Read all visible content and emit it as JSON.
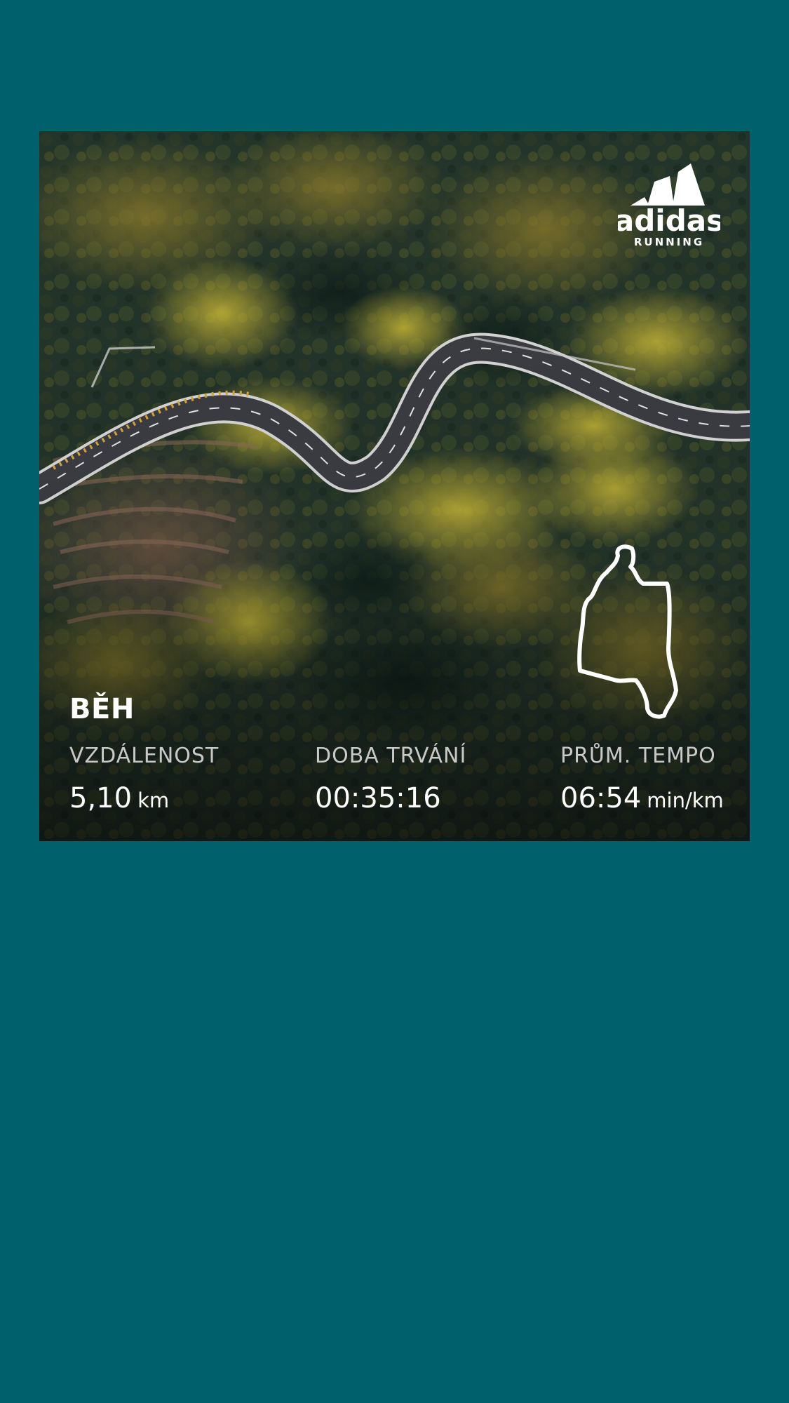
{
  "share_card": {
    "brand": {
      "logo_text": "adidas",
      "logo_subtext": "RUNNING",
      "logo_icon": "adidas-three-stripes-icon"
    },
    "background_image": "aerial-forest-winding-road-photo",
    "route_icon": "route-outline-icon",
    "activity_title": "BĚH",
    "stats": [
      {
        "label": "VZDÁLENOST",
        "value": "5,10",
        "unit": "km"
      },
      {
        "label": "DOBA TRVÁNÍ",
        "value": "00:35:16",
        "unit": ""
      },
      {
        "label": "PRŮM. TEMPO",
        "value": "06:54",
        "unit": "min/km"
      }
    ]
  },
  "colors": {
    "page_background": "#00616c",
    "text_primary": "#ffffff",
    "text_secondary": "#c9c9c9",
    "forest_dark": "#1b2a22",
    "foliage_yellow": "#b3a12c",
    "road": "#3b3d42"
  }
}
